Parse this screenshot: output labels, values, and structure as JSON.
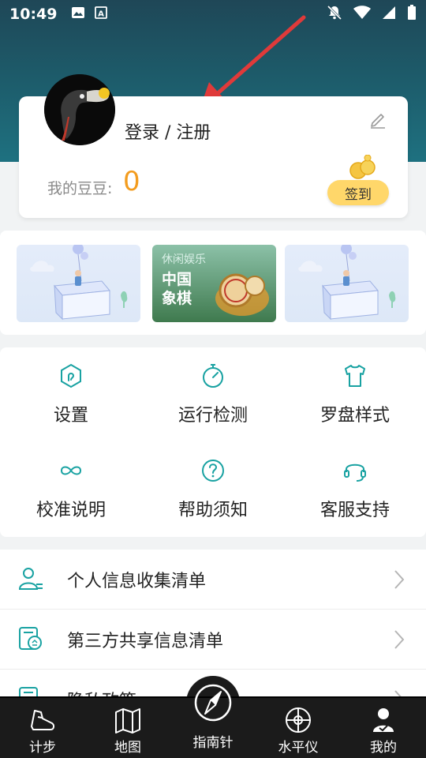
{
  "status_bar": {
    "time": "10:49"
  },
  "profile": {
    "login_label": "登录 / 注册",
    "bean_label": "我的豆豆:",
    "bean_count": "0",
    "signin_button": "签到"
  },
  "banners": [
    {
      "name": "banner-illustration-1"
    },
    {
      "tag": "休闲娱乐",
      "title_line1": "中国",
      "title_line2": "象棋"
    },
    {
      "name": "banner-illustration-3"
    }
  ],
  "grid": [
    {
      "label": "设置",
      "icon": "hexagon-settings-icon"
    },
    {
      "label": "运行检测",
      "icon": "gauge-icon"
    },
    {
      "label": "罗盘样式",
      "icon": "tshirt-icon"
    },
    {
      "label": "校准说明",
      "icon": "infinity-icon"
    },
    {
      "label": "帮助须知",
      "icon": "help-icon"
    },
    {
      "label": "客服支持",
      "icon": "headset-icon"
    }
  ],
  "list": [
    {
      "label": "个人信息收集清单",
      "icon": "user-list-icon"
    },
    {
      "label": "第三方共享信息清单",
      "icon": "share-doc-icon"
    },
    {
      "label": "隐私政策",
      "icon": "privacy-doc-icon"
    }
  ],
  "tabs": [
    {
      "label": "计步",
      "icon": "shoe-icon"
    },
    {
      "label": "地图",
      "icon": "map-icon"
    },
    {
      "label": "指南针",
      "icon": "compass-icon"
    },
    {
      "label": "水平仪",
      "icon": "level-icon"
    },
    {
      "label": "我的",
      "icon": "profile-icon"
    }
  ],
  "colors": {
    "accent": "#19a2a2",
    "bean": "#f39c1e",
    "signin": "#ffd76a",
    "arrow": "#e03a3a"
  }
}
